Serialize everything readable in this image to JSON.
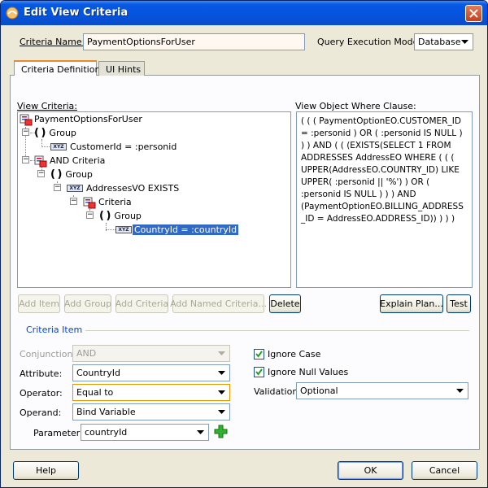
{
  "window": {
    "title": "Edit View Criteria",
    "accent": "#0553de"
  },
  "criteria_name": {
    "label": "Criteria Name:",
    "value": "PaymentOptionsForUser"
  },
  "query_execution": {
    "label": "Query Execution Mode:",
    "value": "Database"
  },
  "tabs": [
    {
      "label": "Criteria Definition",
      "active": true
    },
    {
      "label": "UI Hints",
      "active": false
    }
  ],
  "view_criteria": {
    "label": "View Criteria:",
    "tree": [
      {
        "label": "PaymentOptionsForUser",
        "icon": "criteria-icon"
      },
      {
        "label": "Group",
        "icon": "group-icon"
      },
      {
        "label": "CustomerId = :personid",
        "icon": "attribute-icon"
      },
      {
        "label": "AND Criteria",
        "icon": "criteria-icon"
      },
      {
        "label": "Group",
        "icon": "group-icon"
      },
      {
        "label": "AddressesVO EXISTS",
        "icon": "attribute-icon"
      },
      {
        "label": "Criteria",
        "icon": "criteria-icon"
      },
      {
        "label": "Group",
        "icon": "group-icon"
      },
      {
        "label": "CountryId = :countryId",
        "icon": "attribute-icon",
        "selected": true
      }
    ]
  },
  "where_clause": {
    "label": "View Object Where Clause:",
    "text": "( ( ( PaymentOptionEO.CUSTOMER_ID = :personid ) OR ( :personid IS NULL ) ) ) AND ( ( (EXISTS(SELECT 1 FROM ADDRESSES AddressEO WHERE ( ( ( UPPER(AddressEO.COUNTRY_ID) LIKE UPPER( :personid || '%') ) OR ( :personid IS NULL ) ) ) AND (PaymentOptionEO.BILLING_ADDRESS_ID = AddressEO.ADDRESS_ID)) ) ) )"
  },
  "toolbar": {
    "add_item": "Add Item",
    "add_group": "Add Group",
    "add_criteria": "Add Criteria",
    "add_named_criteria": "Add Named Criteria...",
    "delete": "Delete",
    "explain_plan": "Explain Plan...",
    "test": "Test"
  },
  "criteria_item": {
    "section_label": "Criteria Item",
    "conjunction": {
      "label": "Conjunction:",
      "value": "AND"
    },
    "attribute": {
      "label": "Attribute:",
      "value": "CountryId"
    },
    "operator": {
      "label": "Operator:",
      "value": "Equal to"
    },
    "operand": {
      "label": "Operand:",
      "value": "Bind Variable"
    },
    "parameter": {
      "label": "Parameter:",
      "value": "countryId"
    },
    "ignore_case": {
      "label": "Ignore Case",
      "checked": true
    },
    "ignore_null": {
      "label": "Ignore Null Values",
      "checked": true
    },
    "validation": {
      "label": "Validation:",
      "value": "Optional"
    }
  },
  "footer": {
    "help": "Help",
    "ok": "OK",
    "cancel": "Cancel"
  }
}
